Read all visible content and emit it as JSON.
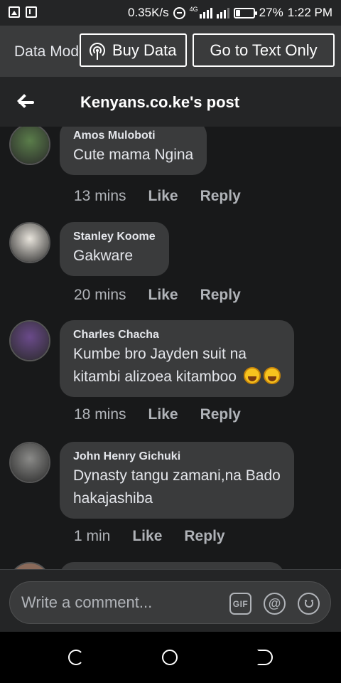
{
  "status_bar": {
    "speed": "0.35K/s",
    "network_tag": "4G",
    "battery_percent": 27,
    "battery_label": "27%",
    "time": "1:22 PM"
  },
  "data_bar": {
    "mode_label": "Data Mode",
    "buy_data_label": "Buy Data",
    "text_only_label": "Go to Text Only"
  },
  "header": {
    "title": "Kenyans.co.ke's post"
  },
  "comments": [
    {
      "author": "Amos Muloboti",
      "text_lines": [
        "Cute mama Ngina"
      ],
      "time": "13 mins",
      "like_label": "Like",
      "reply_label": "Reply",
      "avatar_color": "#5a7d4a"
    },
    {
      "author": "Stanley Koome",
      "text_lines": [
        "Gakware"
      ],
      "time": "20 mins",
      "like_label": "Like",
      "reply_label": "Reply",
      "avatar_color": "#e8e4dc"
    },
    {
      "author": "Charles Chacha",
      "text_lines": [
        "Kumbe bro Jayden suit na",
        "kitambi alizoea kitamboo"
      ],
      "emoji": "rolling-on-floor-laughing x2",
      "time": "18 mins",
      "like_label": "Like",
      "reply_label": "Reply",
      "avatar_color": "#6a4a8a"
    },
    {
      "author": "John Henry Gichuki",
      "text_lines": [
        "Dynasty tangu zamani,na Bado",
        "hakajashiba"
      ],
      "time": "1 min",
      "like_label": "Like",
      "reply_label": "Reply",
      "avatar_color": "#8a8a88"
    }
  ],
  "composer": {
    "placeholder": "Write a comment...",
    "gif_label": "GIF",
    "at_label": "@"
  },
  "colors": {
    "background": "#18191a",
    "bubble": "#3a3b3c",
    "header": "#242526",
    "secondary_text": "#b0b3b8"
  }
}
